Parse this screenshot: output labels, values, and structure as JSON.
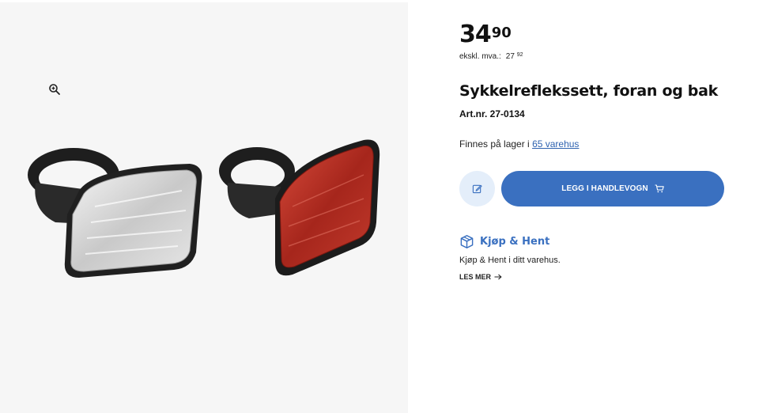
{
  "gallery": {
    "zoom_icon": "zoom-in-icon",
    "image_alt": "Sykkelreflekssett, foran og bak"
  },
  "price": {
    "whole": "34",
    "cents": "90",
    "ex_vat_label": "ekskl. mva.:",
    "ex_vat_whole": "27",
    "ex_vat_cents": "92"
  },
  "product": {
    "title": "Sykkelreflekssett, foran og bak",
    "art_nr": "Art.nr. 27-0134"
  },
  "stock": {
    "prefix": "Finnes på lager i",
    "link": "65 varehus"
  },
  "actions": {
    "list_icon": "edit-icon",
    "cart_label": "LEGG I HANDLEVOGN",
    "cart_icon": "cart-icon"
  },
  "pickup": {
    "icon": "box-icon",
    "title": "Kjøp & Hent",
    "description": "Kjøp & Hent i ditt varehus.",
    "read_more": "LES MER"
  },
  "colors": {
    "accent": "#3a70c0",
    "link": "#2f63b0",
    "light_button": "#e4eefa",
    "gallery_bg": "#f6f6f6"
  }
}
